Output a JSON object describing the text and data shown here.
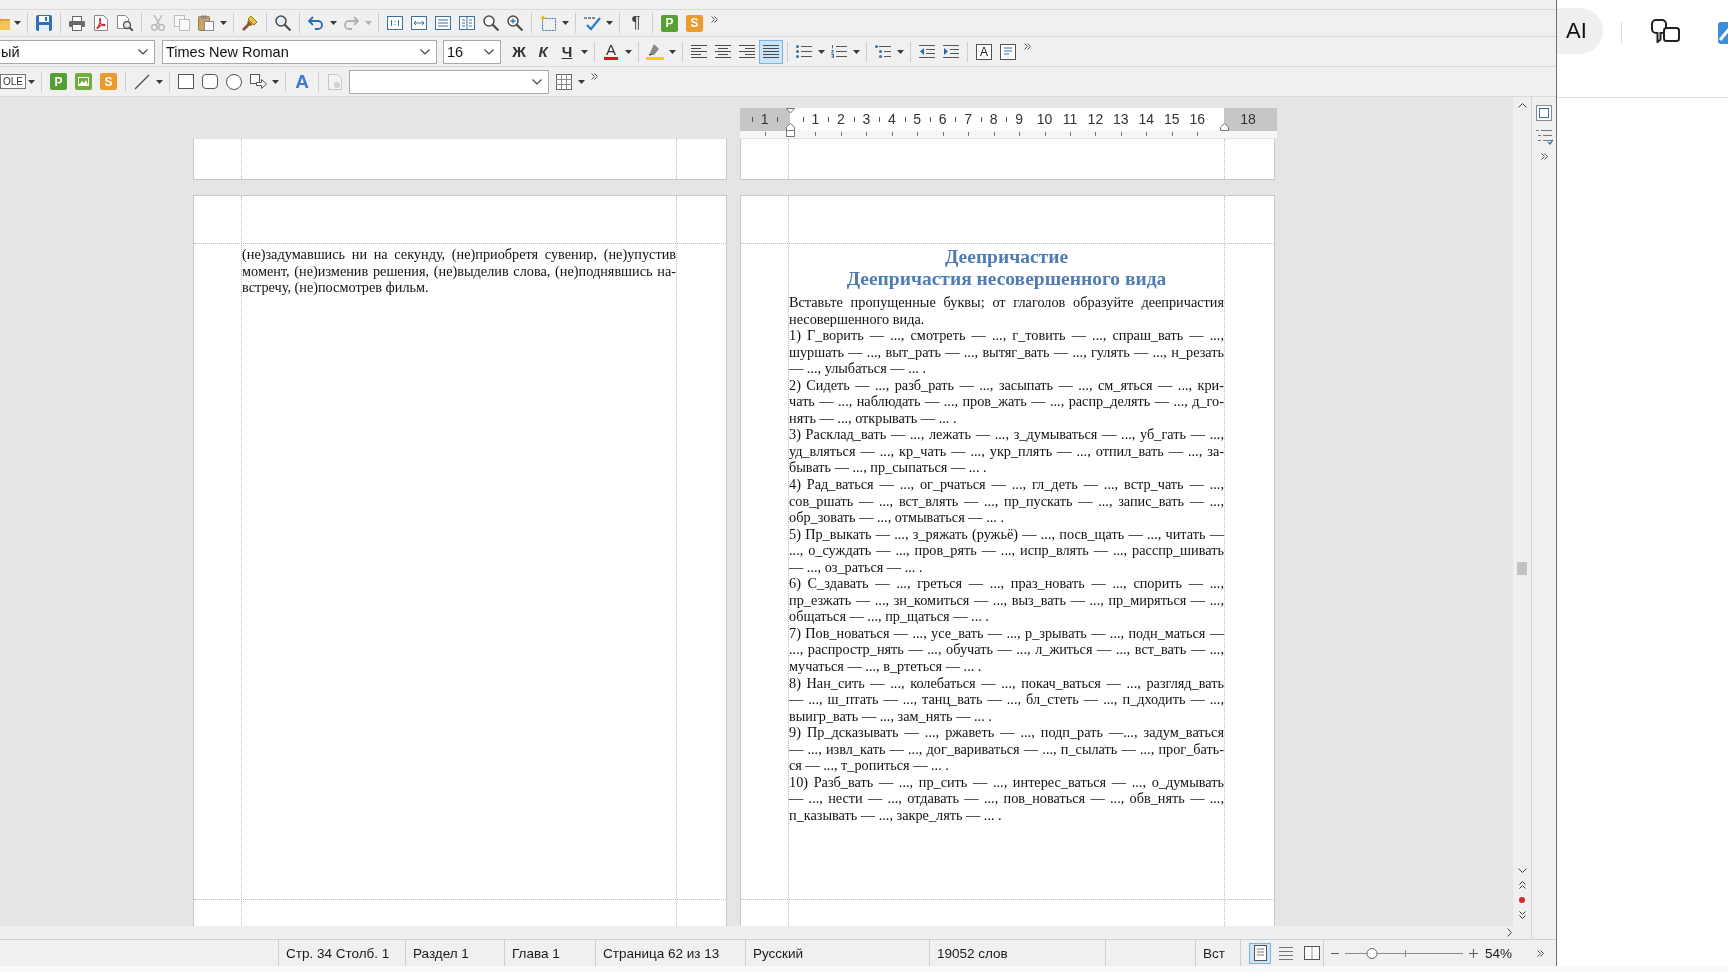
{
  "toolbar_standard": {
    "formatting_marks": "¶",
    "tiles": [
      {
        "label": "P",
        "color": "#55a032"
      },
      {
        "label": "S",
        "color": "#eb9a2c"
      }
    ]
  },
  "toolbar_formatting": {
    "paragraph_style": "ый",
    "font_name": "Times New Roman",
    "font_size": "16",
    "text_styles": [
      {
        "kind": "bold",
        "label": "Ж"
      },
      {
        "kind": "italic",
        "label": "К"
      },
      {
        "kind": "underline",
        "label": "Ч"
      }
    ],
    "font_color": "A",
    "alignment": [
      {
        "kind": "left",
        "selected": false
      },
      {
        "kind": "center",
        "selected": false
      },
      {
        "kind": "right",
        "selected": false
      },
      {
        "kind": "justify",
        "selected": true
      }
    ],
    "text_box": "A"
  },
  "toolbar_drawing": {
    "object": "OLE",
    "tiles": [
      {
        "kind": "letter",
        "label": "P",
        "color": "#55a032"
      },
      {
        "kind": "image",
        "color": "#6fae3c"
      },
      {
        "kind": "letter",
        "label": "S",
        "color": "#eb9a2c"
      }
    ],
    "fontwork": "A"
  },
  "ruler": {
    "left_labels": [
      "1"
    ],
    "labels": [
      "1",
      "2",
      "3",
      "4",
      "5",
      "6",
      "7",
      "8",
      "9",
      "10",
      "11",
      "12",
      "13",
      "14",
      "15",
      "16"
    ],
    "right_labels": [
      "18"
    ]
  },
  "document": {
    "left_page": {
      "paragraphs": [
        [
          "(не)задумавшись ни на секунду, (не)приобретя сувенир, (не)упустив",
          "момент, (не)изменив решения, (не)выделив слова, (не)поднявшись на-",
          "встречу, (не)посмотрев фильм."
        ]
      ]
    },
    "right_page": {
      "title": "Деепричастие",
      "subtitle": "Деепричастия несовершенного вида",
      "paragraphs": [
        [
          "Вставьте пропущенные буквы; от глаголов образуйте деепричастия",
          "несовершенного вида."
        ],
        [
          "1) Г_ворить — ..., смотреть — ..., г_товить — ..., спраш_вать — ...,",
          "шуршать — ..., выт_рать — ..., вытяг_вать — ..., гулять — ..., н_резать",
          "— ..., улыбаться — ... ."
        ],
        [
          "2) Сидеть — ..., разб_рать — ..., засыпать — ..., см_яться — ..., кри-",
          "чать — ..., наблюдать — ..., пров_жать — ..., распр_делять — ..., д_го-",
          "нять — ..., открывать — ... ."
        ],
        [
          "3) Расклад_вать — ..., лежать — ..., з_думываться — ..., уб_гать — ...,",
          "уд_вляться — ..., кр_чать — ..., укр_плять — ..., отпил_вать — ..., за-",
          "бывать — ..., пр_сыпаться — ... ."
        ],
        [
          "4) Рад_ваться — ..., ог_рчаться — ..., гл_деть — ..., встр_чать — ...,",
          "сов_ршать — ..., вст_влять — ..., пр_пускать — ..., запис_вать — ...,",
          "обр_зовать — ..., отмываться — ... ."
        ],
        [
          "5) Пр_выкать — ..., з_ряжать (ружьё) — ..., посв_щать — ..., читать —",
          "..., о_суждать — ..., пров_рять — ..., испр_влять — ..., расспр_шивать",
          "— ..., оз_раться — ... ."
        ],
        [
          "6) С_здавать — ..., греться — ..., праз_новать — ..., спорить — ...,",
          "пр_езжать — ..., зн_комиться — ..., выз_вать — ..., пр_миряться — ...,",
          "общаться — ..., пр_щаться — ... ."
        ],
        [
          "7) Пов_новаться — ..., усе_вать — ..., р_зрывать — ..., подн_маться —",
          "..., распростр_нять — ..., обучать — ..., л_житься — ..., вст_вать — ...,",
          "мучаться — ..., в_ртеться — ... ."
        ],
        [
          "8) Нан_сить — ..., колебаться — ..., покач_ваться — ..., разгляд_вать",
          "— ..., ш_птать — ..., танц_вать — ..., бл_стеть — ..., п_дходить — ...,",
          "выигр_вать — ..., зам_нять — ... ."
        ],
        [
          "9) Пр_дсказывать — ..., ржаветь — ..., подп_рать —..., задум_ваться",
          "— ..., извл_кать — ..., дог_вариваться — ..., п_сылать — ..., прог_бать-",
          "ся — ..., т_ропиться — ... ."
        ],
        [
          "10) Разб_вать — ..., пр_сить — ..., интерес_ваться — ..., о_думывать",
          "— ..., нести — ..., отдавать — ..., пов_новаться — ..., обв_нять — ...,",
          "п_казывать — ..., закре_лять — ... ."
        ]
      ]
    }
  },
  "status_bar": {
    "cursor_position": "Стр. 34 Столб. 1",
    "section": "Раздел 1",
    "chapter": "Глава 1",
    "page_count": "Страница 62 из 13",
    "language": "Русский",
    "word_count": "19052 слов",
    "insert_mode": "Вст",
    "view_buttons": [
      {
        "kind": "single",
        "selected": true
      },
      {
        "kind": "multi",
        "selected": false
      },
      {
        "kind": "book",
        "selected": false
      }
    ],
    "zoom": {
      "level": 0.23
    },
    "zoom_percent": "54%"
  },
  "side_panel": {
    "ai_button": "AI"
  }
}
